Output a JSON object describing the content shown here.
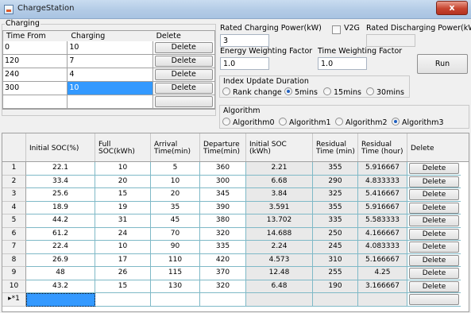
{
  "window": {
    "title": "ChargeStation",
    "close_glyph": "x"
  },
  "charging_group": {
    "label": "Charging",
    "headers": [
      "Time From",
      "Charging",
      "Delete"
    ],
    "rows": [
      {
        "time_from": "0",
        "charging": "10",
        "delete": "Delete"
      },
      {
        "time_from": "120",
        "charging": "7",
        "delete": "Delete"
      },
      {
        "time_from": "240",
        "charging": "4",
        "delete": "Delete"
      },
      {
        "time_from": "300",
        "charging": "10",
        "delete": "Delete"
      },
      {
        "time_from": "",
        "charging": "",
        "delete": ""
      }
    ]
  },
  "settings": {
    "rated_charging_power_label": "Rated Charging Power(kW)",
    "rated_charging_power_value": "3",
    "v2g_label": "V2G",
    "rated_discharging_power_label": "Rated Discharging Power(kW)",
    "rated_discharging_power_value": "",
    "energy_weighting_label": "Energy Weighting Factor",
    "energy_weighting_value": "1.0",
    "time_weighting_label": "Time Weighting Factor",
    "time_weighting_value": "1.0",
    "run_label": "Run"
  },
  "index_update": {
    "label": "Index Update Duration",
    "options": [
      "Rank change",
      "5mins",
      "15mins",
      "30mins"
    ],
    "selected": "5mins"
  },
  "algorithm": {
    "label": "Algorithm",
    "options": [
      "Algorithm0",
      "Algorithm1",
      "Algorithm2",
      "Algorithm3"
    ],
    "selected": "Algorithm3"
  },
  "table": {
    "headers": [
      "Initial SOC(%)",
      "Full SOC(kWh)",
      "Arrival Time(min)",
      "Departure Time(min)",
      "Initial SOC (kWh)",
      "Residual Time (min)",
      "Residual Time (hour)",
      "Delete"
    ],
    "rows": [
      [
        "1",
        "22.1",
        "10",
        "5",
        "360",
        "2.21",
        "355",
        "5.916667",
        "Delete"
      ],
      [
        "2",
        "33.4",
        "20",
        "10",
        "300",
        "6.68",
        "290",
        "4.833333",
        "Delete"
      ],
      [
        "3",
        "25.6",
        "15",
        "20",
        "345",
        "3.84",
        "325",
        "5.416667",
        "Delete"
      ],
      [
        "4",
        "18.9",
        "19",
        "35",
        "390",
        "3.591",
        "355",
        "5.916667",
        "Delete"
      ],
      [
        "5",
        "44.2",
        "31",
        "45",
        "380",
        "13.702",
        "335",
        "5.583333",
        "Delete"
      ],
      [
        "6",
        "61.2",
        "24",
        "70",
        "320",
        "14.688",
        "250",
        "4.166667",
        "Delete"
      ],
      [
        "7",
        "22.4",
        "10",
        "90",
        "335",
        "2.24",
        "245",
        "4.083333",
        "Delete"
      ],
      [
        "8",
        "26.9",
        "17",
        "110",
        "420",
        "4.573",
        "310",
        "5.166667",
        "Delete"
      ],
      [
        "9",
        "48",
        "26",
        "115",
        "370",
        "12.48",
        "255",
        "4.25",
        "Delete"
      ],
      [
        "10",
        "43.2",
        "15",
        "130",
        "320",
        "6.48",
        "190",
        "3.166667",
        "Delete"
      ]
    ],
    "new_row_marker": "▸*1"
  }
}
